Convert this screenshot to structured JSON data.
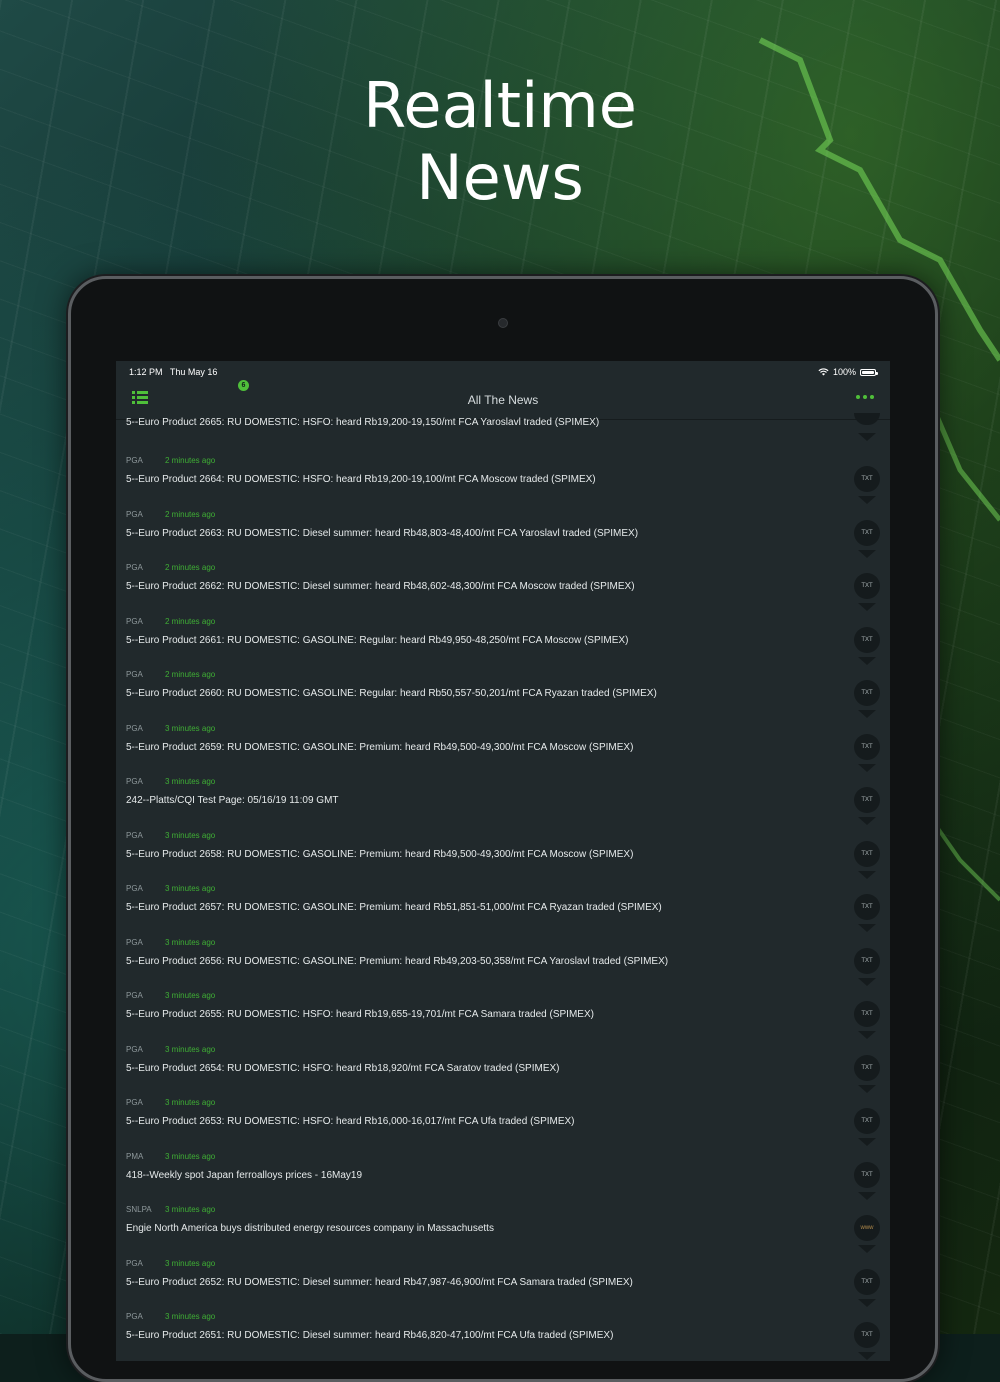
{
  "hero": {
    "title_line1": "Realtime",
    "title_line2": "News"
  },
  "status_bar": {
    "time": "1:12 PM",
    "date": "Thu May 16",
    "battery": "100%"
  },
  "nav": {
    "title": "All The News",
    "badge_count": "6",
    "menu_icon": "list-icon",
    "more_icon": "more-dots-icon"
  },
  "colors": {
    "accent": "#4fbf3a",
    "screen_bg": "#21292c",
    "headline": "#e6eaeb"
  },
  "first_item": {
    "headline": "5--Euro Product 2665: RU DOMESTIC: HSFO: heard Rb19,200-19,150/mt FCA Yaroslavl traded (SPIMEX)"
  },
  "items": [
    {
      "source": "PGA",
      "age": "2 minutes ago",
      "headline": "5--Euro Product 2664: RU DOMESTIC: HSFO: heard Rb19,200-19,100/mt FCA Moscow traded (SPIMEX)",
      "type": "TXT"
    },
    {
      "source": "PGA",
      "age": "2 minutes ago",
      "headline": "5--Euro Product 2663: RU DOMESTIC: Diesel summer: heard Rb48,803-48,400/mt FCA Yaroslavl traded (SPIMEX)",
      "type": "TXT"
    },
    {
      "source": "PGA",
      "age": "2 minutes ago",
      "headline": "5--Euro Product 2662: RU DOMESTIC: Diesel summer: heard Rb48,602-48,300/mt FCA Moscow traded (SPIMEX)",
      "type": "TXT"
    },
    {
      "source": "PGA",
      "age": "2 minutes ago",
      "headline": "5--Euro Product 2661: RU DOMESTIC: GASOLINE: Regular: heard Rb49,950-48,250/mt FCA Moscow  (SPIMEX)",
      "type": "TXT"
    },
    {
      "source": "PGA",
      "age": "2 minutes ago",
      "headline": "5--Euro Product 2660: RU DOMESTIC: GASOLINE: Regular: heard Rb50,557-50,201/mt FCA Ryazan traded (SPIMEX)",
      "type": "TXT"
    },
    {
      "source": "PGA",
      "age": "3 minutes ago",
      "headline": "5--Euro Product 2659: RU DOMESTIC: GASOLINE: Premium: heard Rb49,500-49,300/mt FCA Moscow  (SPIMEX)",
      "type": "TXT"
    },
    {
      "source": "PGA",
      "age": "3 minutes ago",
      "headline": "242--Platts/CQI Test Page: 05/16/19 11:09 GMT",
      "type": "TXT"
    },
    {
      "source": "PGA",
      "age": "3 minutes ago",
      "headline": "5--Euro Product 2658: RU DOMESTIC: GASOLINE: Premium: heard Rb49,500-49,300/mt FCA Moscow  (SPIMEX)",
      "type": "TXT"
    },
    {
      "source": "PGA",
      "age": "3 minutes ago",
      "headline": "5--Euro Product 2657: RU DOMESTIC: GASOLINE: Premium: heard Rb51,851-51,000/mt FCA Ryazan traded (SPIMEX)",
      "type": "TXT"
    },
    {
      "source": "PGA",
      "age": "3 minutes ago",
      "headline": "5--Euro Product 2656: RU DOMESTIC: GASOLINE: Premium: heard Rb49,203-50,358/mt FCA Yaroslavl traded (SPIMEX)",
      "type": "TXT"
    },
    {
      "source": "PGA",
      "age": "3 minutes ago",
      "headline": "5--Euro Product 2655: RU DOMESTIC: HSFO: heard Rb19,655-19,701/mt FCA Samara traded (SPIMEX)",
      "type": "TXT"
    },
    {
      "source": "PGA",
      "age": "3 minutes ago",
      "headline": "5--Euro Product 2654: RU DOMESTIC: HSFO: heard Rb18,920/mt FCA Saratov traded (SPIMEX)",
      "type": "TXT"
    },
    {
      "source": "PGA",
      "age": "3 minutes ago",
      "headline": "5--Euro Product 2653: RU DOMESTIC: HSFO: heard Rb16,000-16,017/mt FCA Ufa traded (SPIMEX)",
      "type": "TXT"
    },
    {
      "source": "PMA",
      "age": "3 minutes ago",
      "headline": "418--Weekly spot Japan ferroalloys prices - 16May19",
      "type": "TXT"
    },
    {
      "source": "SNLPA",
      "age": "3 minutes ago",
      "headline": "Engie North America buys distributed energy resources company in Massachusetts",
      "type": "www"
    },
    {
      "source": "PGA",
      "age": "3 minutes ago",
      "headline": "5--Euro Product 2652: RU DOMESTIC: Diesel summer:  heard Rb47,987-46,900/mt FCA Samara traded (SPIMEX)",
      "type": "TXT"
    },
    {
      "source": "PGA",
      "age": "3 minutes ago",
      "headline": "5--Euro Product 2651: RU DOMESTIC: Diesel summer:  heard Rb46,820-47,100/mt FCA Ufa  traded (SPIMEX)",
      "type": "TXT"
    }
  ]
}
